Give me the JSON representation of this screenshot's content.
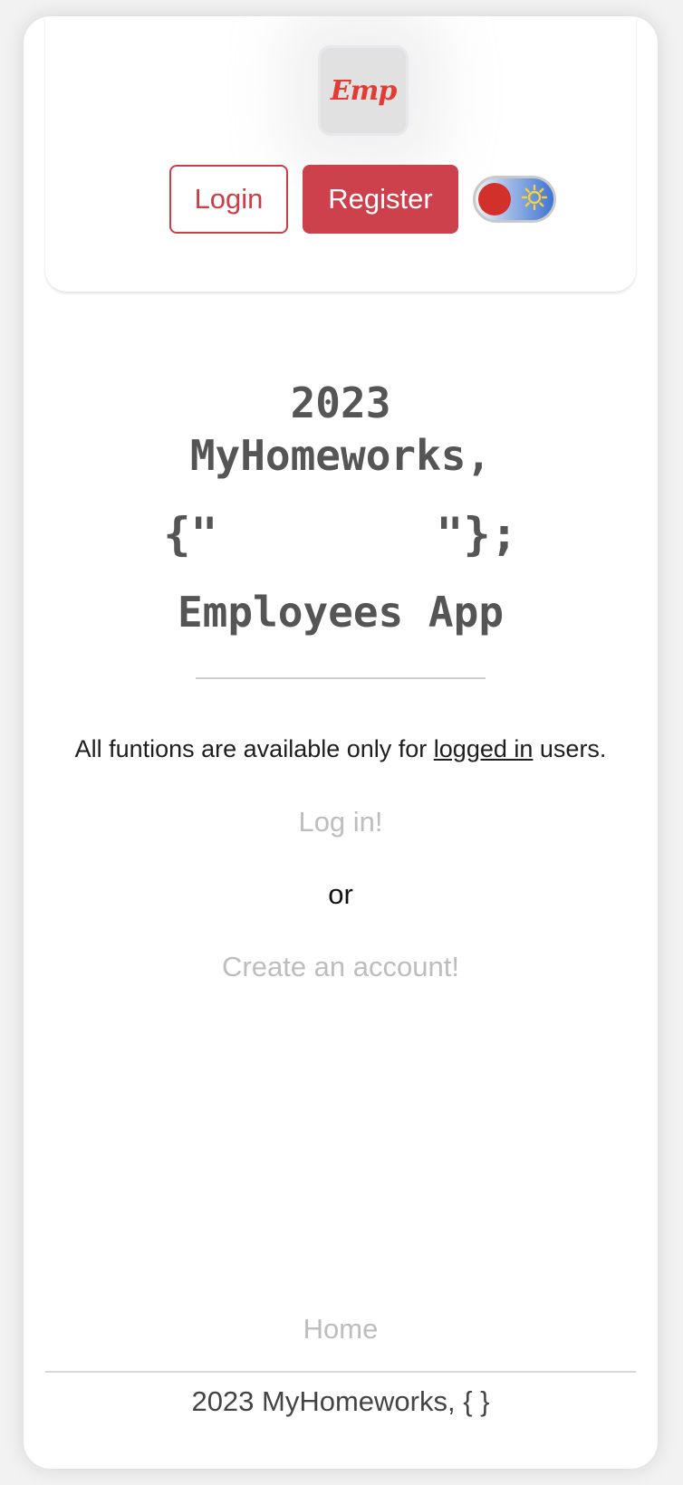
{
  "header": {
    "logo_text": "Emp",
    "login_label": "Login",
    "register_label": "Register",
    "theme_toggle": {
      "state": "light",
      "knob_color": "#d2302a"
    }
  },
  "hero": {
    "line1": "2023",
    "line2": "MyHomeworks,",
    "line3": "{\"        \"};",
    "line4": "Employees App"
  },
  "notice": {
    "prefix": "All funtions are available only for ",
    "link": "logged in",
    "suffix": " users."
  },
  "actions": {
    "login_link": "Log in!",
    "or": "or",
    "create_link": "Create an account!"
  },
  "footer": {
    "home_link": "Home",
    "copyright": "2023 MyHomeworks, { }"
  },
  "colors": {
    "accent": "#cc414b",
    "muted_link": "#bdbdbd",
    "title": "#555555"
  }
}
